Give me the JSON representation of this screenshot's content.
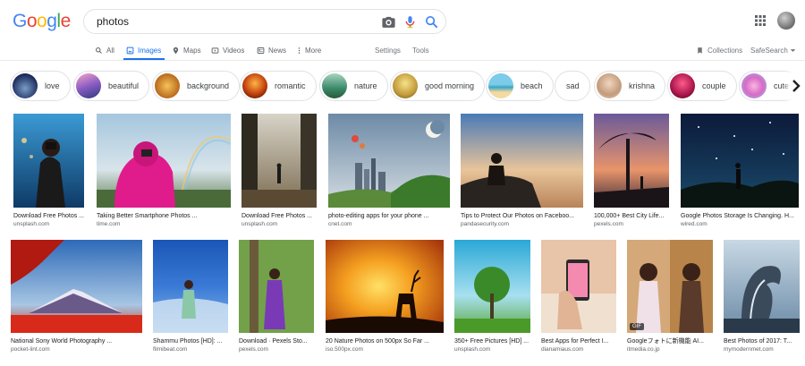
{
  "logo": {
    "text": "Google"
  },
  "search": {
    "query": "photos"
  },
  "tabs": {
    "all": "All",
    "images": "Images",
    "maps": "Maps",
    "videos": "Videos",
    "news": "News",
    "more": "More",
    "settings": "Settings",
    "tools": "Tools",
    "collections": "Collections",
    "safesearch": "SafeSearch"
  },
  "chips": [
    {
      "label": "love"
    },
    {
      "label": "beautiful"
    },
    {
      "label": "background"
    },
    {
      "label": "romantic"
    },
    {
      "label": "nature"
    },
    {
      "label": "good morning"
    },
    {
      "label": "beach"
    },
    {
      "label": "sad"
    },
    {
      "label": "krishna"
    },
    {
      "label": "couple"
    },
    {
      "label": "cute"
    }
  ],
  "results": [
    {
      "title": "Download Free Photos ...",
      "source": "unsplash.com"
    },
    {
      "title": "Taking Better Smartphone Photos ...",
      "source": "time.com"
    },
    {
      "title": "Download Free Photos ...",
      "source": "unsplash.com"
    },
    {
      "title": "photo-editing apps for your phone ...",
      "source": "cnet.com"
    },
    {
      "title": "Tips to Protect Our Photos on Faceboo...",
      "source": "pandasecurity.com"
    },
    {
      "title": "100,000+ Best City Life...",
      "source": "pexels.com"
    },
    {
      "title": "Google Photos Storage Is Changing. H...",
      "source": "wired.com"
    },
    {
      "title": "National Sony World Photography ...",
      "source": "pocket-lint.com"
    },
    {
      "title": "Shammu Photos [HD]: ...",
      "source": "filmibeat.com"
    },
    {
      "title": "Download · Pexels Sto...",
      "source": "pexels.com"
    },
    {
      "title": "20 Nature Photos on 500px So Far ...",
      "source": "iso.500px.com"
    },
    {
      "title": "350+ Free Pictures [HD] ...",
      "source": "unsplash.com"
    },
    {
      "title": "Best Apps for Perfect I...",
      "source": "dianamiaus.com"
    },
    {
      "title": "Googleフォトに新機能 AI...",
      "source": "itmedia.co.jp",
      "badge": "GIF"
    },
    {
      "title": "Best Photos of 2017: T...",
      "source": "mymodernmet.com"
    }
  ]
}
